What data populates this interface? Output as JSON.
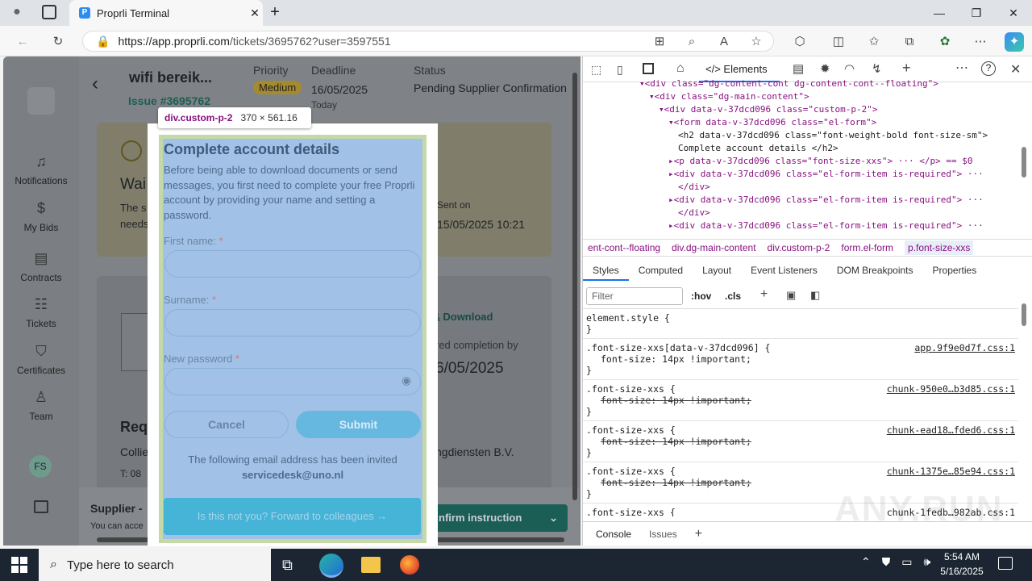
{
  "browser": {
    "tab_title": "Proprli Terminal",
    "url_host": "https://app.proprli.com",
    "url_path": "/tickets/3695762?user=3597551"
  },
  "sidebar": {
    "items": [
      {
        "label": "Notifications",
        "icon": "bell-icon"
      },
      {
        "label": "My Bids",
        "icon": "dollar-icon"
      },
      {
        "label": "Contracts",
        "icon": "document-icon"
      },
      {
        "label": "Tickets",
        "icon": "ticket-icon"
      },
      {
        "label": "Certificates",
        "icon": "shield-icon"
      },
      {
        "label": "Team",
        "icon": "team-icon"
      }
    ],
    "avatar": "FS"
  },
  "ticket": {
    "title": "wifi bereik...",
    "issue": "Issue #3695762",
    "priority_label": "Priority",
    "priority": "Medium",
    "deadline_label": "Deadline",
    "deadline": "16/05/2025",
    "deadline_sub": "Today",
    "status_label": "Status",
    "status": "Pending Supplier Confirmation"
  },
  "background": {
    "wait": "Wai",
    "line1": "The s",
    "line2": "needs",
    "sent_on_label": "Sent on",
    "sent_on": "15/05/2025 10:21",
    "download": "Download",
    "completion": "red completion by",
    "completion_date": "6/05/2025",
    "req": "Req",
    "collie": "Collie",
    "company": "ngdiensten B.V.",
    "phone": "T: 08",
    "supplier": "Supplier -",
    "you_can": "You can acce",
    "confirm": "nfirm instruction"
  },
  "tooltip": {
    "selector": "div.custom-p-2",
    "size": "370 × 561.16"
  },
  "modal": {
    "title": "Complete account details",
    "description": "Before being able to download documents or send messages, you first need to complete your free Proprli account by providing your name and setting a password.",
    "first_name_label": "First name:",
    "surname_label": "Surname:",
    "password_label": "New password",
    "required_mark": "*",
    "cancel": "Cancel",
    "submit": "Submit",
    "invited_text": "The following email address has been invited",
    "email": "servicedesk@uno.nl",
    "forward": "Is this not you? Forward to colleagues →"
  },
  "devtools": {
    "tabs": {
      "elements": "Elements"
    },
    "dom": [
      {
        "indent": 0,
        "text": "▾<div class=\"dg-content-cont dg-content-cont--floating\">"
      },
      {
        "indent": 1,
        "text": "▾<div class=\"dg-main-content\">"
      },
      {
        "indent": 2,
        "text": "▾<div data-v-37dcd096 class=\"custom-p-2\">"
      },
      {
        "indent": 3,
        "text": "▾<form data-v-37dcd096 class=\"el-form\">"
      },
      {
        "indent": 4,
        "text": "<h2 data-v-37dcd096 class=\"font-weight-bold font-size-sm\">"
      },
      {
        "indent": 4,
        "text": "Complete account details </h2>"
      },
      {
        "indent": 3,
        "text": "▸<p data-v-37dcd096 class=\"font-size-xxs\"> ··· </p> == $0"
      },
      {
        "indent": 3,
        "text": "▸<div data-v-37dcd096 class=\"el-form-item is-required\"> ···"
      },
      {
        "indent": 4,
        "text": "</div>"
      },
      {
        "indent": 3,
        "text": "▸<div data-v-37dcd096 class=\"el-form-item is-required\"> ···"
      },
      {
        "indent": 4,
        "text": "</div>"
      },
      {
        "indent": 3,
        "text": "▸<div data-v-37dcd096 class=\"el-form-item is-required\"> ···"
      }
    ],
    "breadcrumbs": [
      "ent-cont--floating",
      "div.dg-main-content",
      "div.custom-p-2",
      "form.el-form",
      "p.font-size-xxs"
    ],
    "subtabs": [
      "Styles",
      "Computed",
      "Layout",
      "Event Listeners",
      "DOM Breakpoints",
      "Properties"
    ],
    "filter_placeholder": "Filter",
    "hov": ":hov",
    "cls": ".cls",
    "rules": [
      {
        "selector": "element.style {",
        "prop": "",
        "source": "",
        "struck": false
      },
      {
        "selector": ".font-size-xxs[data-v-37dcd096] {",
        "prop": "font-size: 14px !important;",
        "source": "app.9f9e0d7f.css:1",
        "struck": false
      },
      {
        "selector": ".font-size-xxs {",
        "prop": "font-size: 14px !important;",
        "source": "chunk-950e0…b3d85.css:1",
        "struck": true
      },
      {
        "selector": ".font-size-xxs {",
        "prop": "font-size: 14px !important;",
        "source": "chunk-ead18…fded6.css:1",
        "struck": true
      },
      {
        "selector": ".font-size-xxs {",
        "prop": "font-size: 14px !important;",
        "source": "chunk-1375e…85e94.css:1",
        "struck": true
      },
      {
        "selector": ".font-size-xxs {",
        "prop": "",
        "source": "chunk-1fedb…982ab.css:1",
        "struck": false
      }
    ],
    "drawer": {
      "console": "Console",
      "issues": "Issues"
    }
  },
  "taskbar": {
    "search": "Type here to search",
    "time": "5:54 AM",
    "date": "5/16/2025"
  },
  "watermark": "ANY.RUN"
}
